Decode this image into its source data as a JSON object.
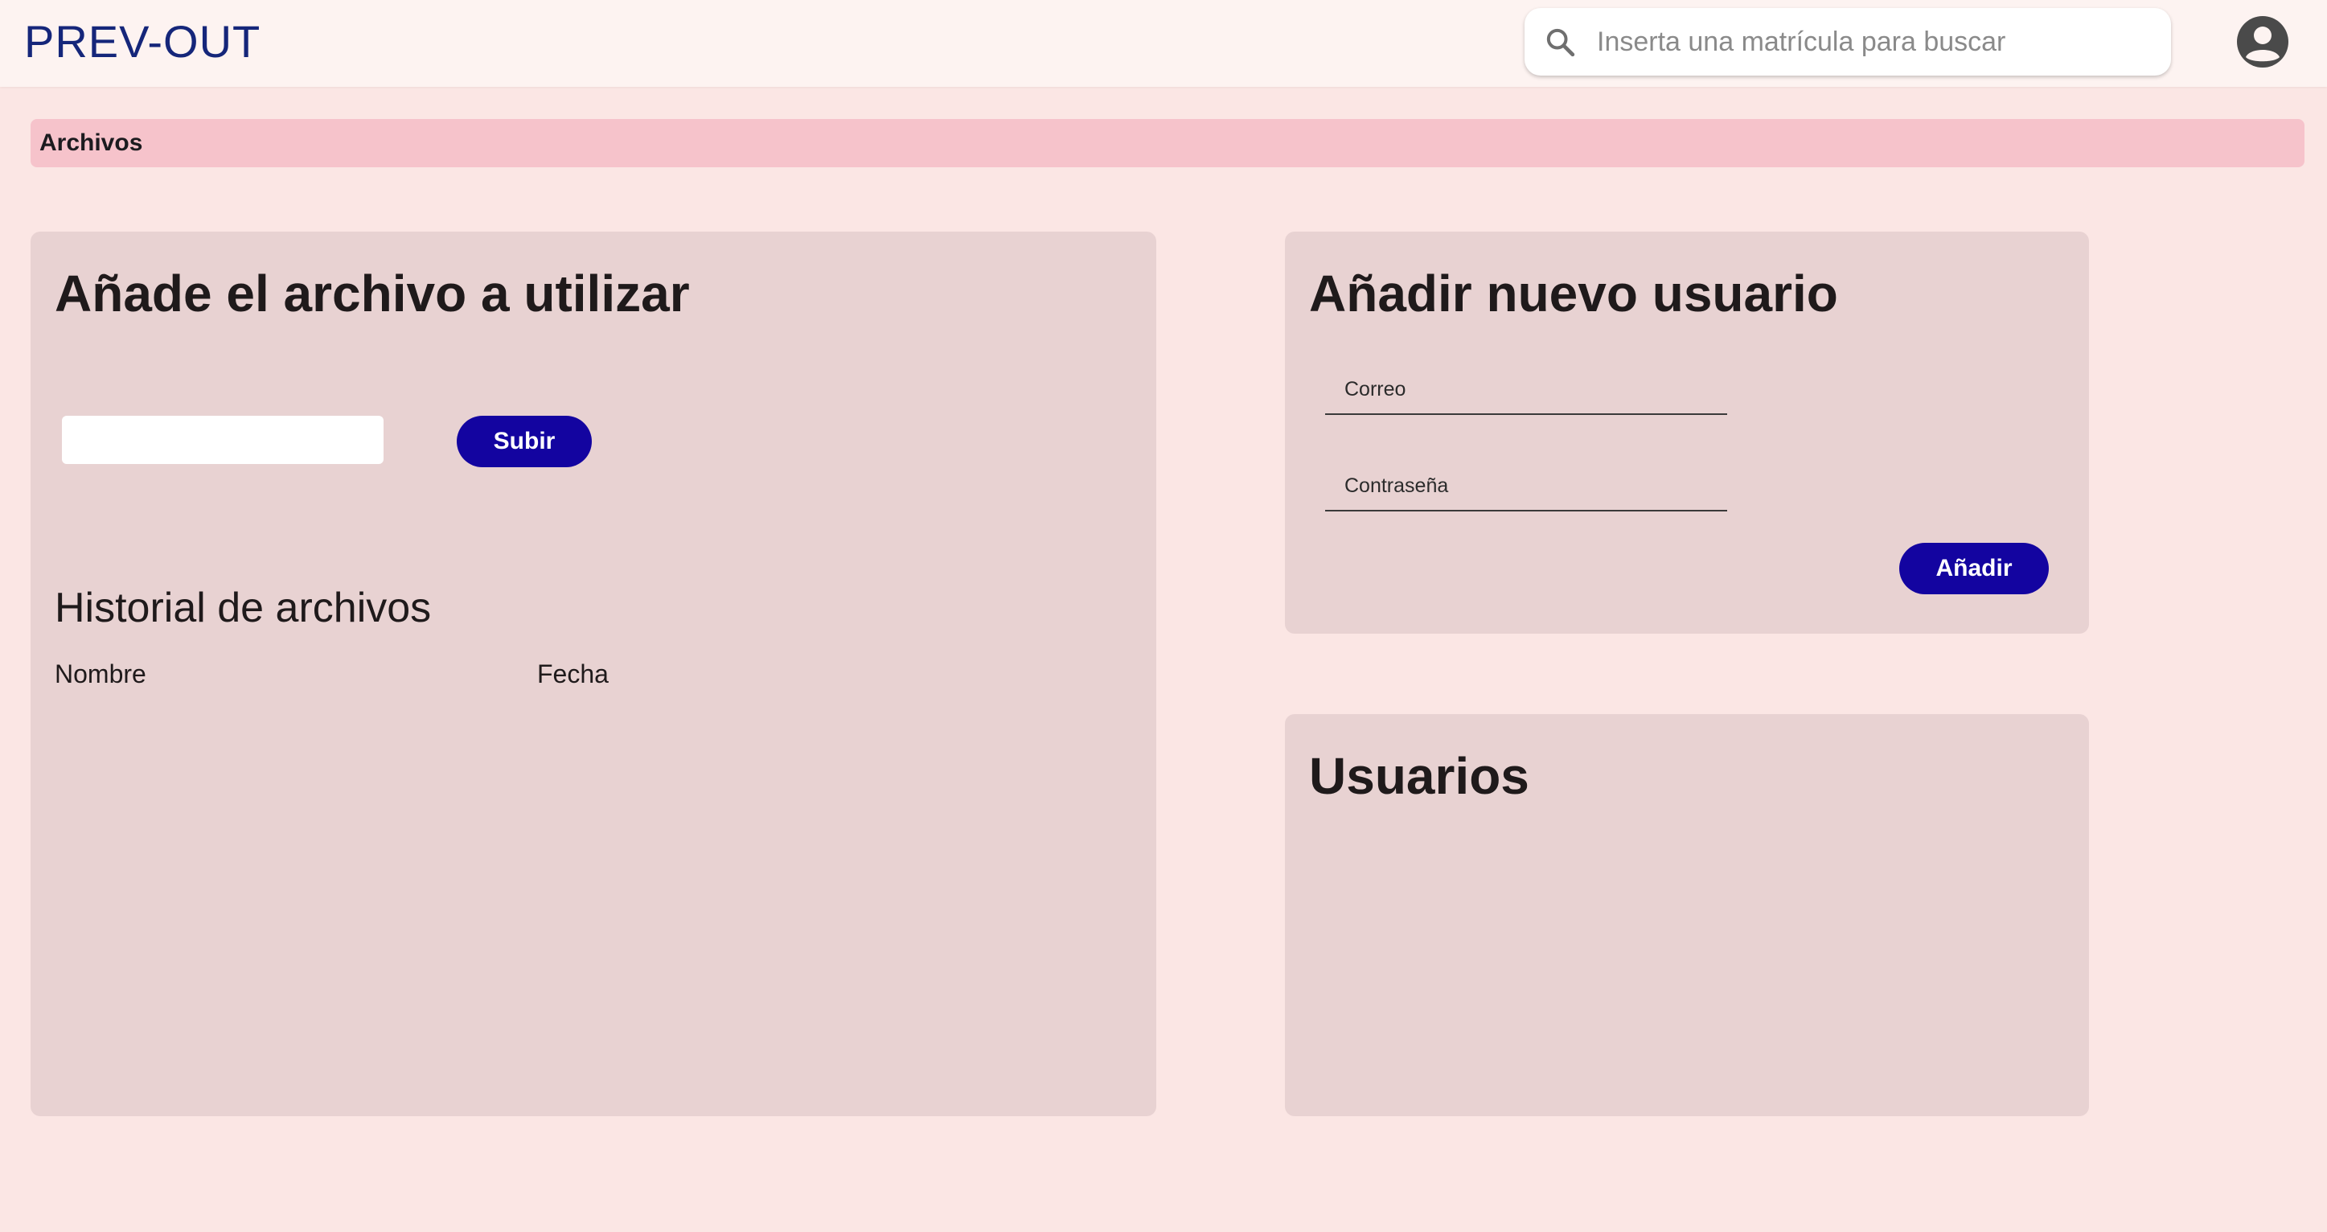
{
  "header": {
    "brand": "PREV-OUT",
    "search_placeholder": "Inserta una matrícula para buscar",
    "search_icon": "search-icon",
    "avatar_icon": "account-circle-icon"
  },
  "breadcrumb": {
    "label": "Archivos"
  },
  "upload_card": {
    "title": "Añade el archivo a utilizar",
    "upload_button": "Subir",
    "history_title": "Historial de archivos",
    "columns": [
      "Nombre",
      "Fecha"
    ]
  },
  "new_user_card": {
    "title": "Añadir nuevo usuario",
    "email_label": "Correo",
    "password_label": "Contraseña",
    "add_button": "Añadir"
  },
  "users_card": {
    "title": "Usuarios"
  },
  "colors": {
    "page_bg": "#fbe6e4",
    "header_bg": "#fdf3f1",
    "brand": "#15267a",
    "breadcrumb_bg": "#f6c3cb",
    "card_bg": "#e8d2d2",
    "button_bg": "#1304a0"
  }
}
